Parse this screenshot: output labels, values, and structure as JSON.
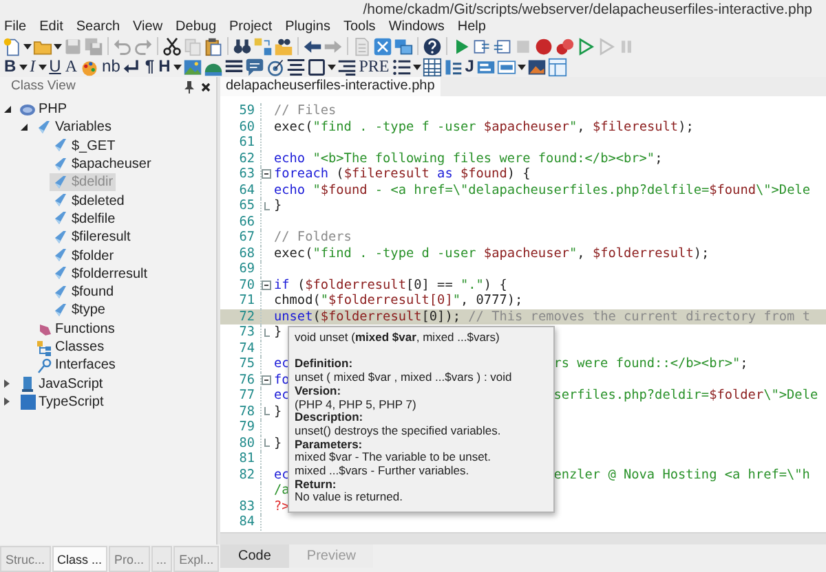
{
  "window": {
    "title": "/home/ckadm/Git/scripts/webserver/delapacheuserfiles-interactive.php"
  },
  "menu": [
    "File",
    "Edit",
    "Search",
    "View",
    "Debug",
    "Project",
    "Plugins",
    "Tools",
    "Windows",
    "Help"
  ],
  "toolbar1": [
    {
      "disabled": false,
      "dropdown": true
    },
    {
      "disabled": false,
      "dropdown": true
    },
    {
      "disabled": true,
      "dropdown": false
    },
    {
      "disabled": true,
      "dropdown": false
    },
    {
      "disabled": true,
      "dropdown": false
    },
    {
      "disabled": true,
      "dropdown": false
    },
    {
      "disabled": false,
      "dropdown": false
    },
    {
      "disabled": true,
      "dropdown": false
    },
    {
      "disabled": false,
      "dropdown": false
    },
    {
      "disabled": false,
      "dropdown": false
    },
    {
      "disabled": false,
      "dropdown": false
    },
    {
      "disabled": false,
      "dropdown": false
    },
    {
      "disabled": false,
      "dropdown": false
    },
    {
      "disabled": true,
      "dropdown": false
    },
    {
      "disabled": true,
      "dropdown": false
    },
    {
      "disabled": false,
      "dropdown": false
    },
    {
      "disabled": false,
      "dropdown": false
    },
    {
      "disabled": false,
      "dropdown": false
    },
    {
      "disabled": false,
      "dropdown": false
    },
    {
      "disabled": false,
      "dropdown": false
    },
    {
      "disabled": false,
      "dropdown": false
    },
    {
      "disabled": true,
      "dropdown": false
    },
    {
      "disabled": false,
      "dropdown": false
    },
    {
      "disabled": false,
      "dropdown": false
    },
    {
      "disabled": false,
      "dropdown": false
    },
    {
      "disabled": true,
      "dropdown": false
    },
    {
      "disabled": true,
      "dropdown": false
    }
  ],
  "toolbar2": [
    {
      "kind": "glyph",
      "label": "B",
      "dropdown": true
    },
    {
      "kind": "glyph",
      "label": "I",
      "dropdown": true
    },
    {
      "kind": "glyph",
      "label": "U",
      "dropdown": false
    },
    {
      "kind": "glyph",
      "label": "A",
      "dropdown": false
    },
    {
      "kind": "icon",
      "dropdown": false
    },
    {
      "kind": "glyph",
      "label": "nb",
      "dropdown": false
    },
    {
      "kind": "icon",
      "dropdown": false
    },
    {
      "kind": "glyph",
      "label": "¶",
      "dropdown": false
    },
    {
      "kind": "glyph",
      "label": "H",
      "dropdown": true
    },
    {
      "kind": "icon",
      "dropdown": false
    },
    {
      "kind": "icon",
      "dropdown": false
    },
    {
      "kind": "icon",
      "dropdown": false
    },
    {
      "kind": "icon",
      "dropdown": false
    },
    {
      "kind": "icon",
      "dropdown": false
    },
    {
      "kind": "icon",
      "dropdown": false
    },
    {
      "kind": "icon",
      "dropdown": true
    },
    {
      "kind": "icon",
      "dropdown": false
    },
    {
      "kind": "glyph",
      "label": "PRE",
      "dropdown": false
    },
    {
      "kind": "icon",
      "dropdown": true
    },
    {
      "kind": "icon",
      "dropdown": false
    },
    {
      "kind": "icon",
      "dropdown": false
    },
    {
      "kind": "glyph",
      "label": "J",
      "dropdown": false
    },
    {
      "kind": "icon",
      "dropdown": false
    },
    {
      "kind": "icon",
      "dropdown": true
    },
    {
      "kind": "icon",
      "dropdown": false
    },
    {
      "kind": "icon",
      "dropdown": false
    }
  ],
  "sidebar": {
    "title": "Class View",
    "tree": [
      {
        "label": "PHP",
        "kind": "php",
        "selected": false,
        "expanded": true,
        "children": [
          {
            "label": "Variables",
            "kind": "variable",
            "selected": false,
            "expanded": true,
            "children": [
              {
                "label": "$_GET",
                "kind": "variable",
                "selected": false
              },
              {
                "label": "$apacheuser",
                "kind": "variable",
                "selected": false
              },
              {
                "label": "$deldir",
                "kind": "variable",
                "selected": true
              },
              {
                "label": "$deleted",
                "kind": "variable",
                "selected": false
              },
              {
                "label": "$delfile",
                "kind": "variable",
                "selected": false
              },
              {
                "label": "$fileresult",
                "kind": "variable",
                "selected": false
              },
              {
                "label": "$folder",
                "kind": "variable",
                "selected": false
              },
              {
                "label": "$folderresult",
                "kind": "variable",
                "selected": false
              },
              {
                "label": "$found",
                "kind": "variable",
                "selected": false
              },
              {
                "label": "$type",
                "kind": "variable",
                "selected": false
              }
            ]
          },
          {
            "label": "Functions",
            "kind": "function",
            "selected": false
          },
          {
            "label": "Classes",
            "kind": "class",
            "selected": false
          },
          {
            "label": "Interfaces",
            "kind": "interface",
            "selected": false
          }
        ]
      },
      {
        "label": "JavaScript",
        "kind": "javascript",
        "selected": false,
        "expanded": false
      },
      {
        "label": "TypeScript",
        "kind": "typescript",
        "selected": false,
        "expanded": false
      }
    ],
    "tabs": [
      {
        "label": "Struc...",
        "selected": false
      },
      {
        "label": "Class ...",
        "selected": true
      },
      {
        "label": "Pro...",
        "selected": false
      },
      {
        "label": "...",
        "selected": false
      },
      {
        "label": "Expl...",
        "selected": false
      }
    ]
  },
  "editor": {
    "tabs": [
      {
        "label": "delapacheuserfiles-interactive.php",
        "selected": true
      }
    ],
    "lines": [
      {
        "number": "59",
        "kind": "code",
        "tokens": [
          {
            "kind": "comment",
            "text": "// Files"
          }
        ]
      },
      {
        "number": "60",
        "kind": "code",
        "tokens": [
          {
            "kind": "plain",
            "text": "exec("
          },
          {
            "kind": "string",
            "text": "\"find . -type f -user "
          },
          {
            "kind": "var",
            "text": "$apacheuser"
          },
          {
            "kind": "string",
            "text": "\""
          },
          {
            "kind": "plain",
            "text": ", "
          },
          {
            "kind": "var",
            "text": "$fileresult"
          },
          {
            "kind": "plain",
            "text": ");"
          }
        ]
      },
      {
        "number": "61",
        "kind": "code"
      },
      {
        "number": "62",
        "kind": "code",
        "tokens": [
          {
            "kind": "keyword",
            "text": "echo "
          },
          {
            "kind": "string",
            "text": "\"<b>The following files were found:</b><br>\""
          },
          {
            "kind": "plain",
            "text": ";"
          }
        ]
      },
      {
        "number": "63",
        "kind": "opener",
        "tokens": [
          {
            "kind": "keyword",
            "text": "foreach"
          },
          {
            "kind": "plain",
            "text": " ("
          },
          {
            "kind": "var",
            "text": "$fileresult"
          },
          {
            "kind": "keyword",
            "text": " as "
          },
          {
            "kind": "var",
            "text": "$found"
          },
          {
            "kind": "plain",
            "text": ") {"
          }
        ]
      },
      {
        "number": "64",
        "kind": "code",
        "tokens": [
          {
            "kind": "keyword",
            "text": "echo "
          },
          {
            "kind": "string",
            "text": "\""
          },
          {
            "kind": "var",
            "text": "$found"
          },
          {
            "kind": "string",
            "text": " - <a href=\\\"delapacheuserfiles.php?delfile="
          },
          {
            "kind": "var",
            "text": "$found"
          },
          {
            "kind": "string",
            "text": "\\\">Dele"
          }
        ]
      },
      {
        "number": "65",
        "kind": "closer",
        "tokens": [
          {
            "kind": "plain",
            "text": "}"
          }
        ]
      },
      {
        "number": "66",
        "kind": "code"
      },
      {
        "number": "67",
        "kind": "code",
        "tokens": [
          {
            "kind": "comment",
            "text": "// Folders"
          }
        ]
      },
      {
        "number": "68",
        "kind": "code",
        "tokens": [
          {
            "kind": "plain",
            "text": "exec("
          },
          {
            "kind": "string",
            "text": "\"find . -type d -user "
          },
          {
            "kind": "var",
            "text": "$apacheuser"
          },
          {
            "kind": "string",
            "text": "\""
          },
          {
            "kind": "plain",
            "text": ", "
          },
          {
            "kind": "var",
            "text": "$folderresult"
          },
          {
            "kind": "plain",
            "text": ");"
          }
        ]
      },
      {
        "number": "69",
        "kind": "code"
      },
      {
        "number": "70",
        "kind": "opener",
        "tokens": [
          {
            "kind": "keyword",
            "text": "if"
          },
          {
            "kind": "plain",
            "text": " ("
          },
          {
            "kind": "var",
            "text": "$folderresult"
          },
          {
            "kind": "plain",
            "text": "[0] == "
          },
          {
            "kind": "string",
            "text": "\".\""
          },
          {
            "kind": "plain",
            "text": ") {"
          }
        ]
      },
      {
        "number": "71",
        "kind": "code",
        "tokens": [
          {
            "kind": "plain",
            "text": "chmod("
          },
          {
            "kind": "string",
            "text": "\""
          },
          {
            "kind": "var",
            "text": "$folderresult[0]"
          },
          {
            "kind": "string",
            "text": "\""
          },
          {
            "kind": "plain",
            "text": ", 0777);"
          }
        ]
      },
      {
        "number": "72",
        "kind": "code",
        "highlighted": true,
        "tokens": [
          {
            "kind": "keyword",
            "text": "unset"
          },
          {
            "kind": "plain",
            "text": "("
          },
          {
            "kind": "var",
            "text": "$folderresult"
          },
          {
            "kind": "plain",
            "text": "[0]); "
          },
          {
            "kind": "comment",
            "text": "// This removes the current directory from t"
          }
        ]
      },
      {
        "number": "73",
        "kind": "closer",
        "tokens": [
          {
            "kind": "plain",
            "text": "}"
          }
        ]
      },
      {
        "number": "74",
        "kind": "code"
      },
      {
        "number": "75",
        "kind": "code",
        "tokens": [
          {
            "kind": "keyword",
            "text": "ec"
          }
        ],
        "right": [
          {
            "kind": "string",
            "text": "rs were found::</b><br>\""
          },
          {
            "kind": "plain",
            "text": ";"
          }
        ]
      },
      {
        "number": "76",
        "kind": "opener",
        "tokens": [
          {
            "kind": "keyword",
            "text": "fo"
          }
        ]
      },
      {
        "number": "77",
        "kind": "code",
        "tokens": [
          {
            "kind": "keyword",
            "text": "ec"
          }
        ],
        "right": [
          {
            "kind": "string",
            "text": "serfiles.php?deldir="
          },
          {
            "kind": "var",
            "text": "$folder"
          },
          {
            "kind": "string",
            "text": "\\\">Dele"
          }
        ]
      },
      {
        "number": "78",
        "kind": "closer",
        "tokens": [
          {
            "kind": "plain",
            "text": "}"
          }
        ]
      },
      {
        "number": "79",
        "kind": "code"
      },
      {
        "number": "80",
        "kind": "closer",
        "tokens": [
          {
            "kind": "plain",
            "text": "}"
          }
        ]
      },
      {
        "number": "81",
        "kind": "code"
      },
      {
        "number": "82",
        "kind": "code",
        "tokens": [
          {
            "kind": "keyword",
            "text": "ec"
          }
        ],
        "right": [
          {
            "kind": "string",
            "text": "enzler @ Nova Hosting <a href=\\\"h"
          }
        ],
        "wrap": [
          {
            "kind": "string",
            "text": "/a"
          }
        ]
      },
      {
        "number": "83",
        "kind": "code",
        "tokens": [
          {
            "kind": "tag",
            "text": "?>"
          }
        ]
      },
      {
        "number": "84",
        "kind": "code"
      }
    ],
    "tooltip": {
      "signature": "void unset (**mixed $var**, mixed ...$vars)",
      "sections": [
        {
          "heading": "Definition:",
          "lines": [
            "unset ( mixed $var , mixed ...$vars ) : void"
          ]
        },
        {
          "heading": "Version:",
          "lines": [
            "(PHP 4, PHP 5, PHP 7)"
          ]
        },
        {
          "heading": "Description:",
          "lines": [
            "unset() destroys the specified variables."
          ]
        },
        {
          "heading": "Parameters:",
          "lines": [
            "mixed $var - The variable to be unset.",
            "mixed ...$vars - Further variables."
          ]
        },
        {
          "heading": "Return:",
          "lines": [
            "No value is returned."
          ]
        }
      ]
    },
    "bottom_tabs": [
      {
        "label": "Code",
        "selected": true
      },
      {
        "label": "Preview",
        "selected": false
      }
    ]
  }
}
